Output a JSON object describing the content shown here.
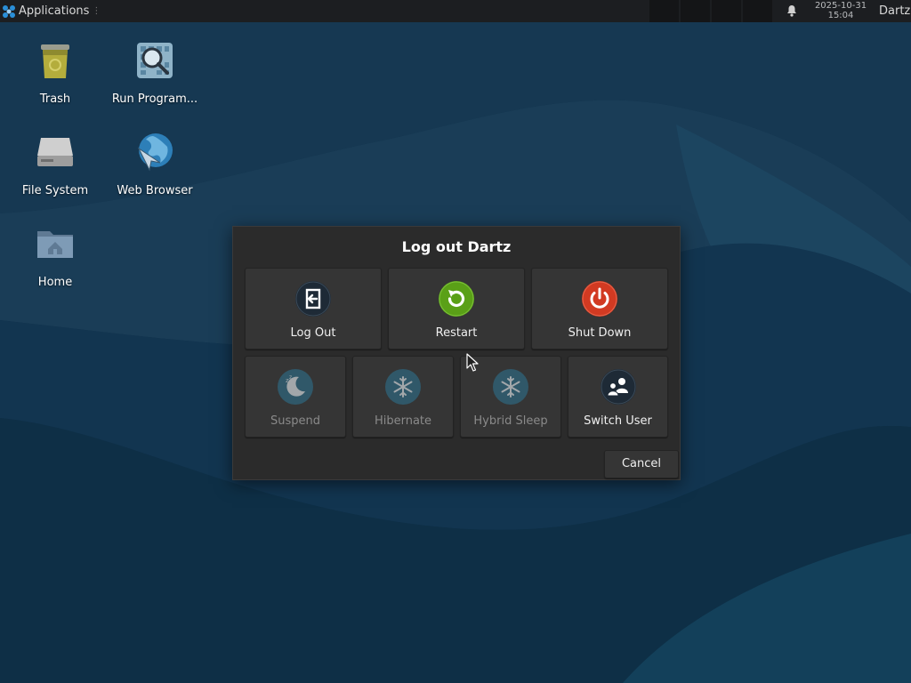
{
  "panel": {
    "applications_label": "Applications",
    "clock_date": "2025-10-31",
    "clock_time": "15:04",
    "user": "Dartz"
  },
  "desktop": {
    "icons": [
      {
        "label": "Trash",
        "icon": "trash-icon"
      },
      {
        "label": "Run Program...",
        "icon": "run-program-icon"
      },
      {
        "label": "File System",
        "icon": "file-system-icon"
      },
      {
        "label": "Web Browser",
        "icon": "web-browser-icon"
      },
      {
        "label": "Home",
        "icon": "home-folder-icon"
      }
    ]
  },
  "dialog": {
    "title": "Log out Dartz",
    "actions": [
      {
        "label": "Log Out",
        "icon": "log-out-icon",
        "enabled": true
      },
      {
        "label": "Restart",
        "icon": "restart-icon",
        "enabled": true
      },
      {
        "label": "Shut Down",
        "icon": "shut-down-icon",
        "enabled": true
      },
      {
        "label": "Suspend",
        "icon": "suspend-icon",
        "enabled": false
      },
      {
        "label": "Hibernate",
        "icon": "hibernate-icon",
        "enabled": false
      },
      {
        "label": "Hybrid Sleep",
        "icon": "hybrid-sleep-icon",
        "enabled": false
      },
      {
        "label": "Switch User",
        "icon": "switch-user-icon",
        "enabled": true
      }
    ],
    "cancel_label": "Cancel"
  },
  "colors": {
    "desktop_bg": "#0f3048",
    "panel_bg": "#1c1e21",
    "dialog_bg": "#2b2b2b",
    "button_bg": "#353535",
    "restart_green": "#5aa017",
    "shutdown_red": "#d23a22",
    "suspend_teal": "#2d6e8a"
  }
}
